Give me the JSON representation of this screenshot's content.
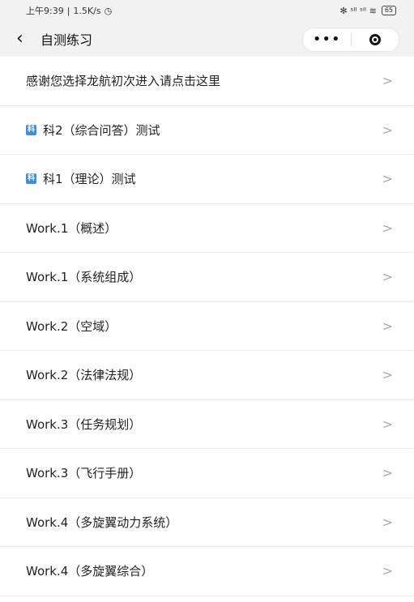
{
  "status": {
    "time": "上午9:39",
    "net_speed": "1.5K/s",
    "signal": "✻ ˢᴵᴵ ˢᴵᴵ ≋",
    "battery": "65"
  },
  "nav": {
    "back_glyph": "‹",
    "title": "自测练习",
    "more_glyph": "•••"
  },
  "items": [
    {
      "label": "感谢您选择龙航初次进入请点击这里",
      "has_badge": false
    },
    {
      "label": "科2（综合问答）测试",
      "has_badge": true
    },
    {
      "label": "科1（理论）测试",
      "has_badge": true
    },
    {
      "label": "Work.1（概述）",
      "has_badge": false
    },
    {
      "label": "Work.1（系统组成）",
      "has_badge": false
    },
    {
      "label": "Work.2（空域）",
      "has_badge": false
    },
    {
      "label": "Work.2（法律法规）",
      "has_badge": false
    },
    {
      "label": "Work.3（任务规划）",
      "has_badge": false
    },
    {
      "label": "Work.3（飞行手册）",
      "has_badge": false
    },
    {
      "label": "Work.4（多旋翼动力系统）",
      "has_badge": false
    },
    {
      "label": "Work.4（多旋翼综合）",
      "has_badge": false
    }
  ],
  "badge_text": "科",
  "chevron_glyph": ">",
  "colors": {
    "bar_bg": "#f2f2f2",
    "badge": "#3c8ee0",
    "divider": "#ececec"
  }
}
